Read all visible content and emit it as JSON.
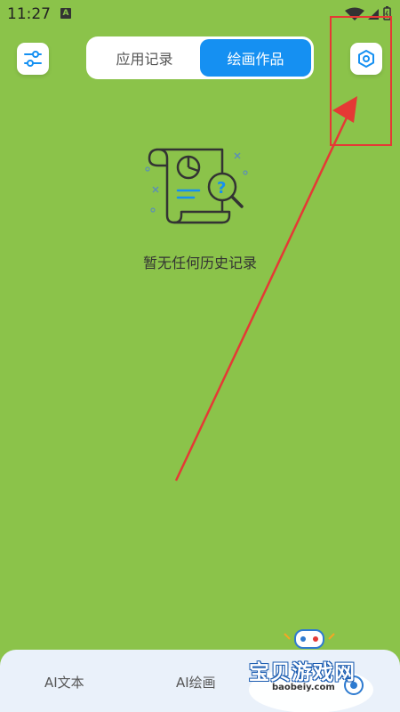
{
  "status_bar": {
    "time": "11:27",
    "notification_letter": "A"
  },
  "tabs": [
    {
      "label": "应用记录",
      "active": false
    },
    {
      "label": "绘画作品",
      "active": true
    }
  ],
  "empty_state": {
    "message": "暂无任何历史记录"
  },
  "bottom_nav": [
    {
      "label": "AI文本"
    },
    {
      "label": "AI绘画"
    }
  ],
  "watermark": {
    "title": "宝贝游戏网",
    "domain": "baobeiy.com"
  },
  "colors": {
    "background": "#8BC34A",
    "accent": "#1590F2",
    "annotation": "#E53935",
    "nav_bg": "#EAF1FA"
  },
  "icons": {
    "filter": "sliders-icon",
    "settings": "hexagon-settings-icon",
    "empty": "document-search-illustration"
  }
}
